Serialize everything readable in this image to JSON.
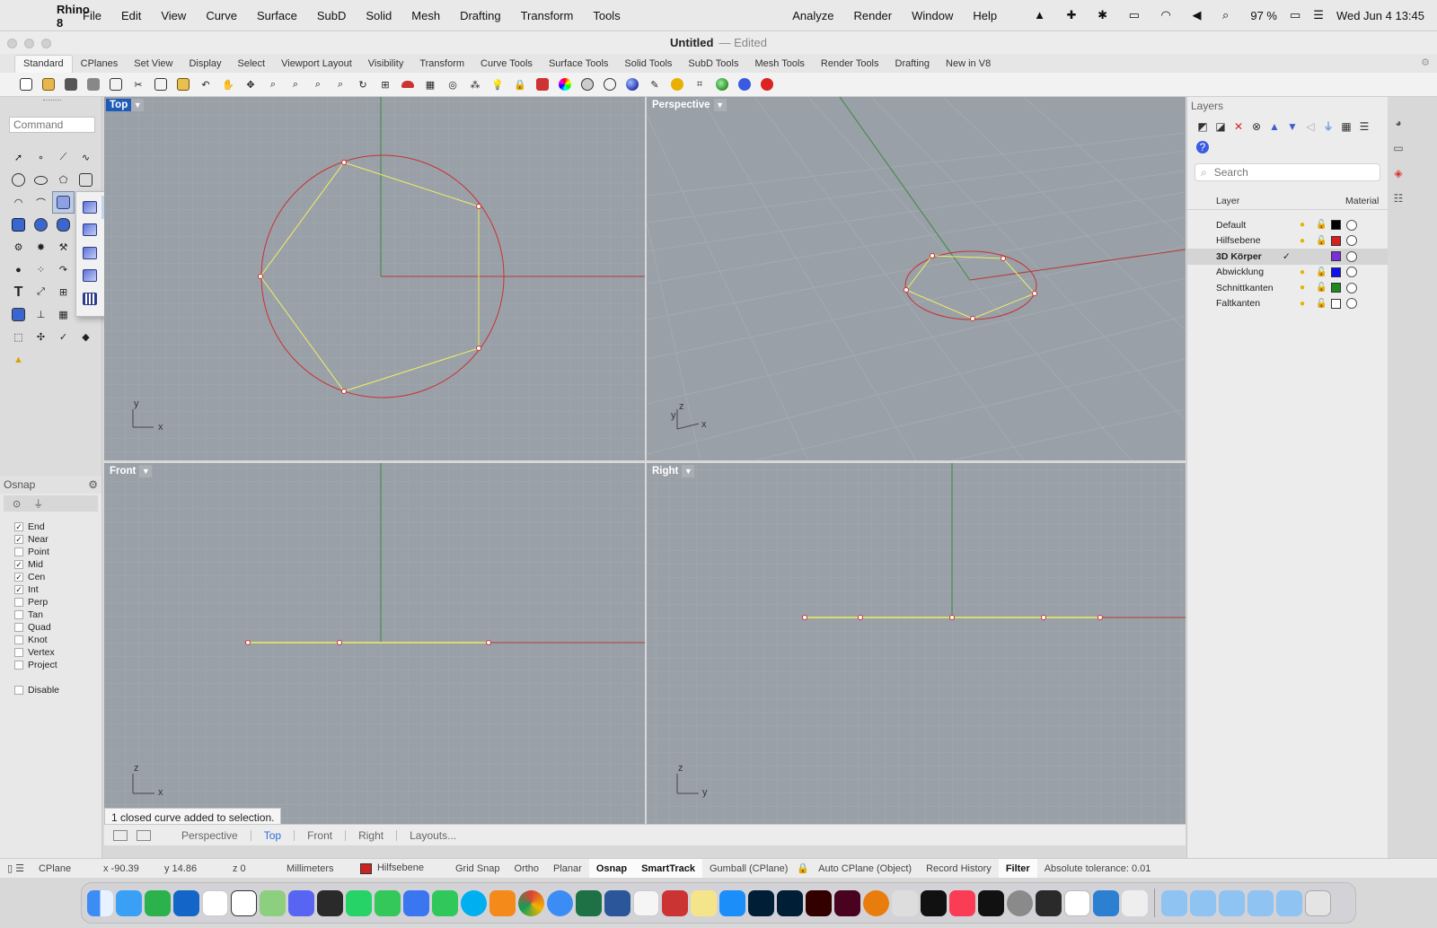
{
  "menubar": {
    "app": "Rhino 8",
    "items": [
      "File",
      "Edit",
      "View",
      "Curve",
      "Surface",
      "SubD",
      "Solid",
      "Mesh",
      "Drafting",
      "Transform",
      "Tools"
    ],
    "right_items": [
      "Analyze",
      "Render",
      "Window",
      "Help"
    ],
    "battery": "97 %",
    "clock": "Wed Jun 4  13:45"
  },
  "window": {
    "title": "Untitled",
    "status": "Edited"
  },
  "toolbar_tabs": [
    "Standard",
    "CPlanes",
    "Set View",
    "Display",
    "Select",
    "Viewport Layout",
    "Visibility",
    "Transform",
    "Curve Tools",
    "Surface Tools",
    "Solid Tools",
    "SubD Tools",
    "Mesh Tools",
    "Render Tools",
    "Drafting",
    "New in V8"
  ],
  "command": {
    "placeholder": "Command"
  },
  "viewports": {
    "top": "Top",
    "perspective": "Perspective",
    "front": "Front",
    "right": "Right",
    "axis_top": {
      "a": "y",
      "b": "x"
    },
    "axis_persp": {
      "a": "z",
      "b": "x",
      "c": "y"
    },
    "axis_front": {
      "a": "z",
      "b": "x"
    },
    "axis_right": {
      "a": "z",
      "b": "y"
    }
  },
  "toast": "1 closed curve added to selection.",
  "viewport_tabs": [
    "Perspective",
    "Top",
    "Front",
    "Right",
    "Layouts..."
  ],
  "osnap": {
    "title": "Osnap",
    "items": [
      {
        "label": "End",
        "checked": true
      },
      {
        "label": "Near",
        "checked": true
      },
      {
        "label": "Point",
        "checked": false
      },
      {
        "label": "Mid",
        "checked": true
      },
      {
        "label": "Cen",
        "checked": true
      },
      {
        "label": "Int",
        "checked": true
      },
      {
        "label": "Perp",
        "checked": false
      },
      {
        "label": "Tan",
        "checked": false
      },
      {
        "label": "Quad",
        "checked": false
      },
      {
        "label": "Knot",
        "checked": false
      },
      {
        "label": "Vertex",
        "checked": false
      },
      {
        "label": "Project",
        "checked": false
      }
    ],
    "disable": "Disable"
  },
  "layers": {
    "title": "Layers",
    "search_placeholder": "Search",
    "col_layer": "Layer",
    "col_material": "Material",
    "rows": [
      {
        "name": "Default",
        "color": "#000000",
        "current": false
      },
      {
        "name": "Hilfsebene",
        "color": "#d42020",
        "current": false
      },
      {
        "name": "3D Körper",
        "color": "#7b2fd6",
        "current": true
      },
      {
        "name": "Abwicklung",
        "color": "#1010ee",
        "current": false
      },
      {
        "name": "Schnittkanten",
        "color": "#1e8a1e",
        "current": false
      },
      {
        "name": "Faltkanten",
        "color": "#ffffff",
        "current": false
      }
    ]
  },
  "statusbar": {
    "cplane": "CPlane",
    "x": "x -90.39",
    "y": "y 14.86",
    "z": "z 0",
    "units": "Millimeters",
    "layer": "Hilfsebene",
    "grid_snap": "Grid Snap",
    "ortho": "Ortho",
    "planar": "Planar",
    "osnap": "Osnap",
    "smarttrack": "SmartTrack",
    "gumball": "Gumball (CPlane)",
    "auto_cplane": "Auto CPlane (Object)",
    "record_history": "Record History",
    "filter": "Filter",
    "tolerance": "Absolute tolerance: 0.01"
  },
  "colors": {
    "accent": "#1d5bb6",
    "curve_red": "#c83232",
    "curve_yellow": "#f0f060",
    "viewport_bg": "#9aa0a8"
  }
}
